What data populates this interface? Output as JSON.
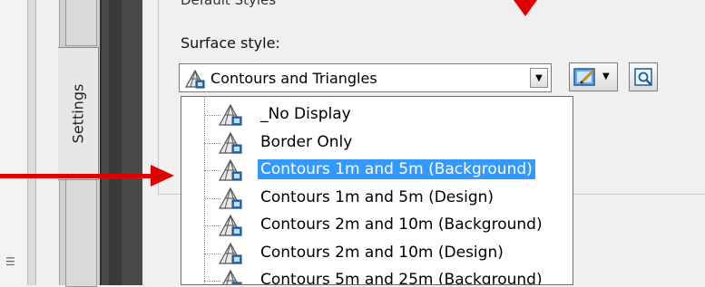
{
  "settings_tab": {
    "label": "Settings"
  },
  "group": {
    "title": "Default Styles"
  },
  "surface_style": {
    "label": "Surface style:",
    "selected_value": "Contours and Triangles"
  },
  "dropdown": {
    "items": [
      {
        "label": "_No Display",
        "selected": false
      },
      {
        "label": "Border Only",
        "selected": false
      },
      {
        "label": "Contours 1m and 5m (Background)",
        "selected": true
      },
      {
        "label": "Contours 1m and 5m (Design)",
        "selected": false
      },
      {
        "label": "Contours 2m and 10m (Background)",
        "selected": false
      },
      {
        "label": "Contours 2m and 10m (Design)",
        "selected": false
      },
      {
        "label": "Contours 5m and 25m (Background)",
        "selected": false
      }
    ]
  },
  "icons": {
    "style_icon": "surface-style-icon",
    "edit_icon": "edit-style-icon",
    "view_icon": "view-style-icon",
    "dropdown_icon": "chevron-down-icon"
  },
  "colors": {
    "selection": "#3399ff",
    "annotation_arrow": "#e00000"
  }
}
